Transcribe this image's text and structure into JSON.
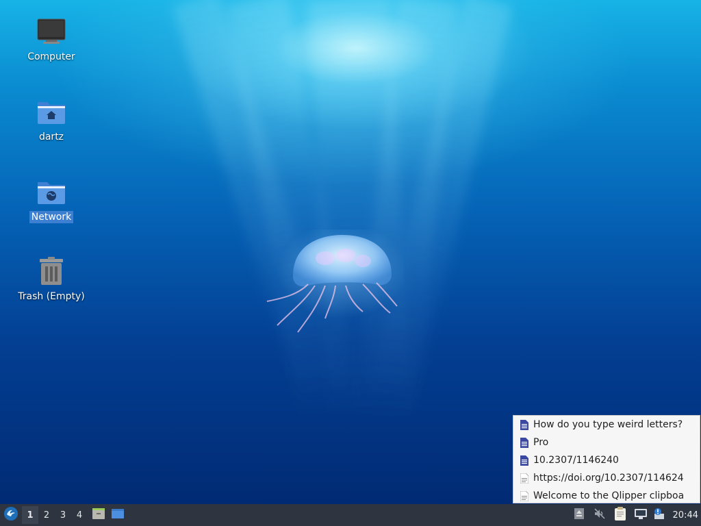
{
  "desktop": {
    "icons": [
      {
        "label": "Computer",
        "icon": "computer-icon"
      },
      {
        "label": "dartz",
        "icon": "home-folder-icon"
      },
      {
        "label": "Network",
        "icon": "network-folder-icon",
        "selected": true
      },
      {
        "label": "Trash (Empty)",
        "icon": "trash-icon"
      }
    ],
    "wallpaper": "underwater-jellyfish"
  },
  "clipboard_menu": {
    "items": [
      {
        "text": "How do you type weird letters?",
        "icon": "document-icon"
      },
      {
        "text": "Pro",
        "icon": "document-icon"
      },
      {
        "text": "10.2307/1146240",
        "icon": "document-icon"
      },
      {
        "text": "https://doi.org/10.2307/114624",
        "icon": "text-file-icon"
      },
      {
        "text": "Welcome to the Qlipper clipboa",
        "icon": "text-file-icon"
      }
    ]
  },
  "taskbar": {
    "start_icon": "lxqt-menu-icon",
    "workspaces": [
      "1",
      "2",
      "3",
      "4"
    ],
    "active_workspace": "1",
    "quicklaunch": [
      "file-manager-icon",
      "show-desktop-icon"
    ],
    "tray": [
      "eject-icon",
      "volume-muted-icon",
      "clipboard-icon",
      "network-icon",
      "update-notifier-icon"
    ],
    "clock": "20:44"
  },
  "colors": {
    "taskbar_bg": "#2e3540",
    "selection": "#3d7fd1",
    "menu_bg": "#f6f6f6",
    "doc_icon": "#3b4aa0"
  }
}
